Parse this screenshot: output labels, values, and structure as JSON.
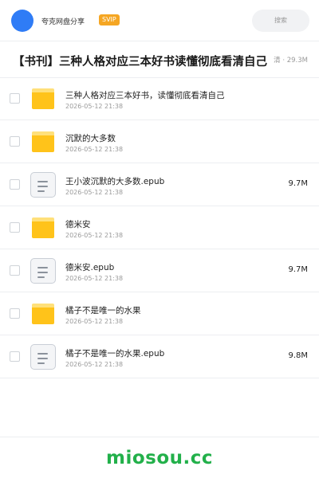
{
  "header": {
    "brand": "夸克网盘分享",
    "badge": "SVIP",
    "search_placeholder": "搜索"
  },
  "folder": {
    "title": "【书刊】三种人格对应三本好书读懂彻底看清自己",
    "meta": "清 · 29.3M"
  },
  "items": [
    {
      "type": "folder",
      "name": "三种人格对应三本好书，读懂彻底看清自己",
      "date": "2026-05-12 21:38",
      "size": ""
    },
    {
      "type": "folder",
      "name": "沉默的大多数",
      "date": "2026-05-12 21:38",
      "size": ""
    },
    {
      "type": "file",
      "name": "王小波沉默的大多数.epub",
      "date": "2026-05-12 21:38",
      "size": "9.7M"
    },
    {
      "type": "folder",
      "name": "德米安",
      "date": "2026-05-12 21:38",
      "size": ""
    },
    {
      "type": "file",
      "name": "德米安.epub",
      "date": "2026-05-12 21:38",
      "size": "9.7M"
    },
    {
      "type": "folder",
      "name": "橘子不是唯一的水果",
      "date": "2026-05-12 21:38",
      "size": ""
    },
    {
      "type": "file",
      "name": "橘子不是唯一的水果.epub",
      "date": "2026-05-12 21:38",
      "size": "9.8M"
    }
  ],
  "watermark": "miosou.cc",
  "colors": {
    "accent": "#2f7cf6",
    "svip": "#f5a623",
    "folder": "#ffc31a",
    "watermark": "#22b04a"
  }
}
